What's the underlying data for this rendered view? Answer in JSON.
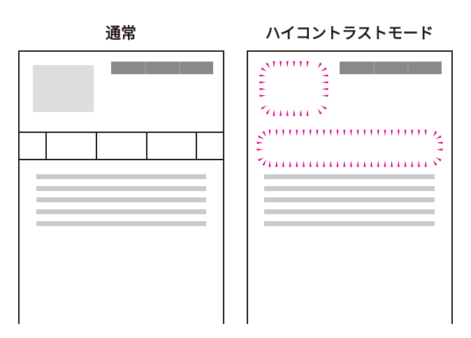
{
  "panels": {
    "normal": {
      "title": "通常"
    },
    "high_contrast": {
      "title": "ハイコントラストモード"
    }
  },
  "colors": {
    "frame": "#231815",
    "header_bar": "#898989",
    "image_placeholder": "#dcdddd",
    "text_line": "#c9caca",
    "focus_highlight": "#e4007f"
  }
}
